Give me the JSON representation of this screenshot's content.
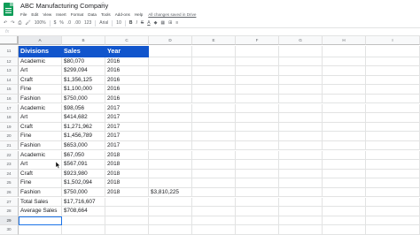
{
  "document": {
    "title": "ABC Manufacturing Company",
    "star_icon": "star-icon",
    "save_status": "All changes saved in Drive"
  },
  "menu": [
    "File",
    "Edit",
    "View",
    "Insert",
    "Format",
    "Data",
    "Tools",
    "Add-ons",
    "Help"
  ],
  "toolbar": {
    "zoom": "100%",
    "currency": "$",
    "percent": "%",
    "decimals_less": ".0",
    "decimals_more": ".00",
    "more_formats": "123",
    "font": "Arial",
    "font_size": "10",
    "bold": "B"
  },
  "formula_bar": {
    "fx_icon": "fx"
  },
  "grid": {
    "columns": [
      "A",
      "B",
      "C",
      "D",
      "E",
      "F",
      "G",
      "H",
      "I"
    ],
    "selected_column": "A",
    "header_row": {
      "row": "11",
      "cells": [
        "Divisions",
        "Sales",
        "Year"
      ]
    },
    "rows": [
      {
        "row": "12",
        "a": "Academic",
        "b": "$80,070",
        "c": "2016",
        "d": ""
      },
      {
        "row": "13",
        "a": "Art",
        "b": "$299,094",
        "c": "2016",
        "d": ""
      },
      {
        "row": "14",
        "a": "Craft",
        "b": "$1,356,125",
        "c": "2016",
        "d": ""
      },
      {
        "row": "15",
        "a": "Fine",
        "b": "$1,100,000",
        "c": "2016",
        "d": ""
      },
      {
        "row": "16",
        "a": "Fashion",
        "b": "$750,000",
        "c": "2016",
        "d": ""
      },
      {
        "row": "17",
        "a": "Academic",
        "b": "$98,056",
        "c": "2017",
        "d": ""
      },
      {
        "row": "18",
        "a": "Art",
        "b": "$414,682",
        "c": "2017",
        "d": ""
      },
      {
        "row": "19",
        "a": "Craft",
        "b": "$1,271,962",
        "c": "2017",
        "d": ""
      },
      {
        "row": "20",
        "a": "Fine",
        "b": "$1,456,789",
        "c": "2017",
        "d": ""
      },
      {
        "row": "21",
        "a": "Fashion",
        "b": "$653,000",
        "c": "2017",
        "d": ""
      },
      {
        "row": "22",
        "a": "Academic",
        "b": "$67,050",
        "c": "2018",
        "d": ""
      },
      {
        "row": "23",
        "a": "Art",
        "b": "$567,091",
        "c": "2018",
        "d": ""
      },
      {
        "row": "24",
        "a": "Craft",
        "b": "$923,980",
        "c": "2018",
        "d": ""
      },
      {
        "row": "25",
        "a": "Fine",
        "b": "$1,502,094",
        "c": "2018",
        "d": ""
      },
      {
        "row": "26",
        "a": "Fashion",
        "b": "$750,000",
        "c": "2018",
        "d": "$3,810,225"
      },
      {
        "row": "27",
        "a": "Total Sales",
        "b": "$17,716,607",
        "c": "",
        "d": ""
      },
      {
        "row": "28",
        "a": "Average Sales",
        "b": "$708,664",
        "c": "",
        "d": ""
      },
      {
        "row": "29",
        "a": "",
        "b": "",
        "c": "",
        "d": ""
      },
      {
        "row": "30",
        "a": "",
        "b": "",
        "c": "",
        "d": ""
      }
    ],
    "selected_row": "29",
    "colors": {
      "header_bg": "#1155cc",
      "header_text": "#ffffff",
      "selection": "#1a73e8"
    }
  }
}
